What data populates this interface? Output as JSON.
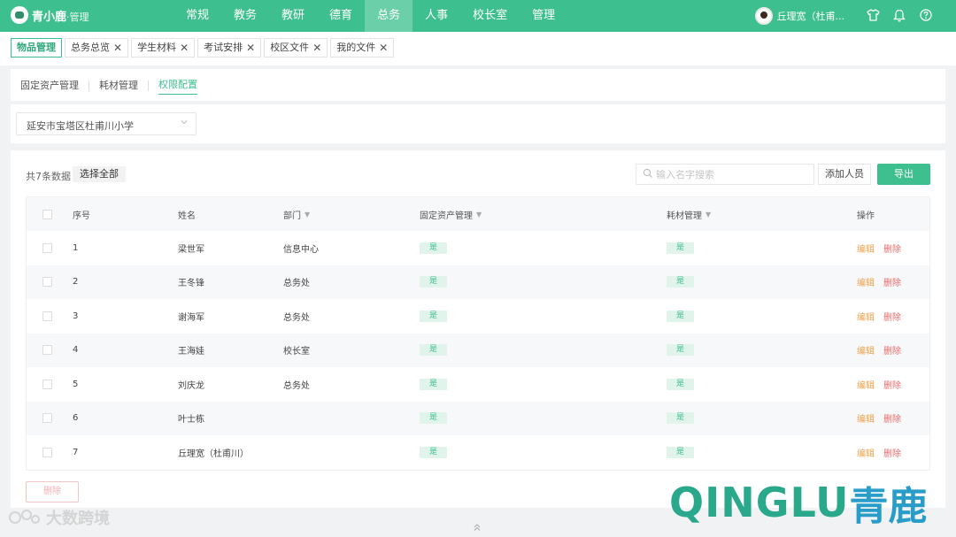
{
  "header": {
    "logo_name": "青小鹿",
    "logo_sub": "·管理",
    "nav": [
      "常规",
      "教务",
      "教研",
      "德育",
      "总务",
      "人事",
      "校长室",
      "管理"
    ],
    "active_nav": "总务",
    "user_name": "丘理宽（杜甫...",
    "icons": [
      "shirt-icon",
      "bell-icon",
      "help-icon"
    ]
  },
  "tabs": [
    {
      "label": "物品管理",
      "active": true
    },
    {
      "label": "总务总览",
      "active": false
    },
    {
      "label": "学生材料",
      "active": false
    },
    {
      "label": "考试安排",
      "active": false
    },
    {
      "label": "校区文件",
      "active": false
    },
    {
      "label": "我的文件",
      "active": false
    }
  ],
  "subtabs": [
    {
      "label": "固定资产管理",
      "active": false
    },
    {
      "label": "耗材管理",
      "active": false
    },
    {
      "label": "权限配置",
      "active": true
    }
  ],
  "school_select": {
    "value": "延安市宝塔区杜甫川小学"
  },
  "toolbar": {
    "count_text": "共7条数据",
    "select_all": "选择全部",
    "search_placeholder": "输入名字搜索",
    "add_label": "添加人员",
    "export_label": "导出"
  },
  "table": {
    "columns": [
      "序号",
      "姓名",
      "部门",
      "固定资产管理",
      "耗材管理",
      "操作"
    ],
    "rows": [
      {
        "no": "1",
        "name": "梁世军",
        "dept": "信息中心",
        "asset": "是",
        "consumable": "是"
      },
      {
        "no": "2",
        "name": "王冬锋",
        "dept": "总务处",
        "asset": "是",
        "consumable": "是"
      },
      {
        "no": "3",
        "name": "谢海军",
        "dept": "总务处",
        "asset": "是",
        "consumable": "是"
      },
      {
        "no": "4",
        "name": "王海娃",
        "dept": "校长室",
        "asset": "是",
        "consumable": "是"
      },
      {
        "no": "5",
        "name": "刘庆龙",
        "dept": "总务处",
        "asset": "是",
        "consumable": "是"
      },
      {
        "no": "6",
        "name": "叶士栋",
        "dept": "",
        "asset": "是",
        "consumable": "是"
      },
      {
        "no": "7",
        "name": "丘理宽（杜甫川）",
        "dept": "",
        "asset": "是",
        "consumable": "是"
      }
    ],
    "edit_label": "编辑",
    "delete_label": "删除"
  },
  "bulk_delete_label": "删除",
  "watermarks": {
    "left": "大数跨境",
    "right_latin": "QINGLU",
    "right_cn": "青鹿"
  },
  "colors": {
    "accent": "#3dbf8f",
    "edit": "#f0a24b",
    "delete": "#ee6b6b",
    "pill_bg": "#e1f4ec"
  }
}
